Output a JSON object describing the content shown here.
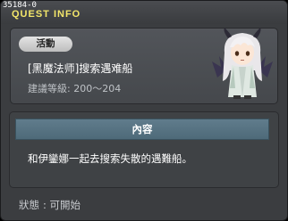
{
  "header": {
    "quest_id": "35184-0",
    "title": "QUEST INFO"
  },
  "quest": {
    "tag": "活動",
    "name": "[黑魔法师]搜索遇难船",
    "level_label": "建議等級",
    "level_range": "200～204"
  },
  "content": {
    "header": "內容",
    "description": "和伊鑾娜一起去搜索失散的遇難船。"
  },
  "status": {
    "label": "狀態",
    "value": "可開始"
  },
  "colors": {
    "title": "#f3e66a",
    "content_header": "#577381",
    "window_bg": "#3b3d40"
  }
}
